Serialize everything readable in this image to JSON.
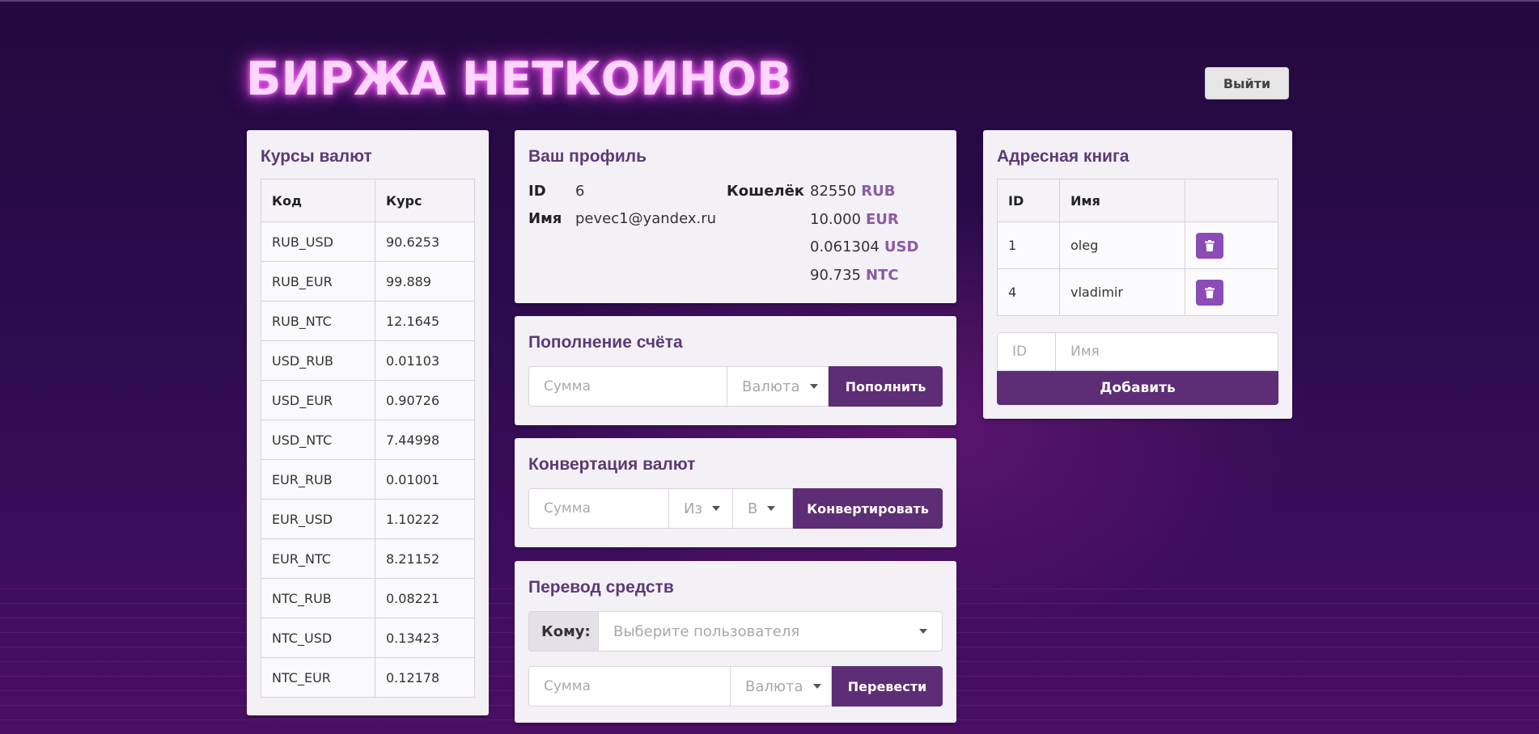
{
  "header": {
    "title": "БИРЖА НЕТКОИНОВ",
    "logout_label": "Выйти"
  },
  "rates": {
    "title": "Курсы валют",
    "columns": [
      "Код",
      "Курс"
    ],
    "rows": [
      [
        "RUB_USD",
        "90.6253"
      ],
      [
        "RUB_EUR",
        "99.889"
      ],
      [
        "RUB_NTC",
        "12.1645"
      ],
      [
        "USD_RUB",
        "0.01103"
      ],
      [
        "USD_EUR",
        "0.90726"
      ],
      [
        "USD_NTC",
        "7.44998"
      ],
      [
        "EUR_RUB",
        "0.01001"
      ],
      [
        "EUR_USD",
        "1.10222"
      ],
      [
        "EUR_NTC",
        "8.21152"
      ],
      [
        "NTC_RUB",
        "0.08221"
      ],
      [
        "NTC_USD",
        "0.13423"
      ],
      [
        "NTC_EUR",
        "0.12178"
      ]
    ]
  },
  "profile": {
    "title": "Ваш профиль",
    "id_label": "ID",
    "id_value": "6",
    "name_label": "Имя",
    "name_value": "pevec1@yandex.ru",
    "wallet_label": "Кошелёк",
    "wallet": [
      {
        "amount": "82550",
        "currency": "RUB"
      },
      {
        "amount": "10.000",
        "currency": "EUR"
      },
      {
        "amount": "0.061304",
        "currency": "USD"
      },
      {
        "amount": "90.735",
        "currency": "NTC"
      }
    ]
  },
  "topup": {
    "title": "Пополнение счёта",
    "amount_placeholder": "Сумма",
    "currency_placeholder": "Валюта",
    "button_label": "Пополнить"
  },
  "convert": {
    "title": "Конвертация валют",
    "amount_placeholder": "Сумма",
    "from_placeholder": "Из",
    "to_placeholder": "В",
    "button_label": "Конвертировать"
  },
  "transfer": {
    "title": "Перевод средств",
    "to_label": "Кому:",
    "user_placeholder": "Выберите пользователя",
    "amount_placeholder": "Сумма",
    "currency_placeholder": "Валюта",
    "button_label": "Перевести"
  },
  "address_book": {
    "title": "Адресная книга",
    "columns": [
      "ID",
      "Имя",
      ""
    ],
    "rows": [
      {
        "id": "1",
        "name": "oleg"
      },
      {
        "id": "4",
        "name": "vladimir"
      }
    ],
    "id_placeholder": "ID",
    "name_placeholder": "Имя",
    "add_label": "Добавить"
  },
  "icons": {
    "delete": "trash-icon",
    "dropdown": "caret-down-icon"
  },
  "colors": {
    "accent": "#5d2d75",
    "title": "#5b3a75",
    "glow": "#ff6cff",
    "delete_button": "#8c4bb5"
  }
}
